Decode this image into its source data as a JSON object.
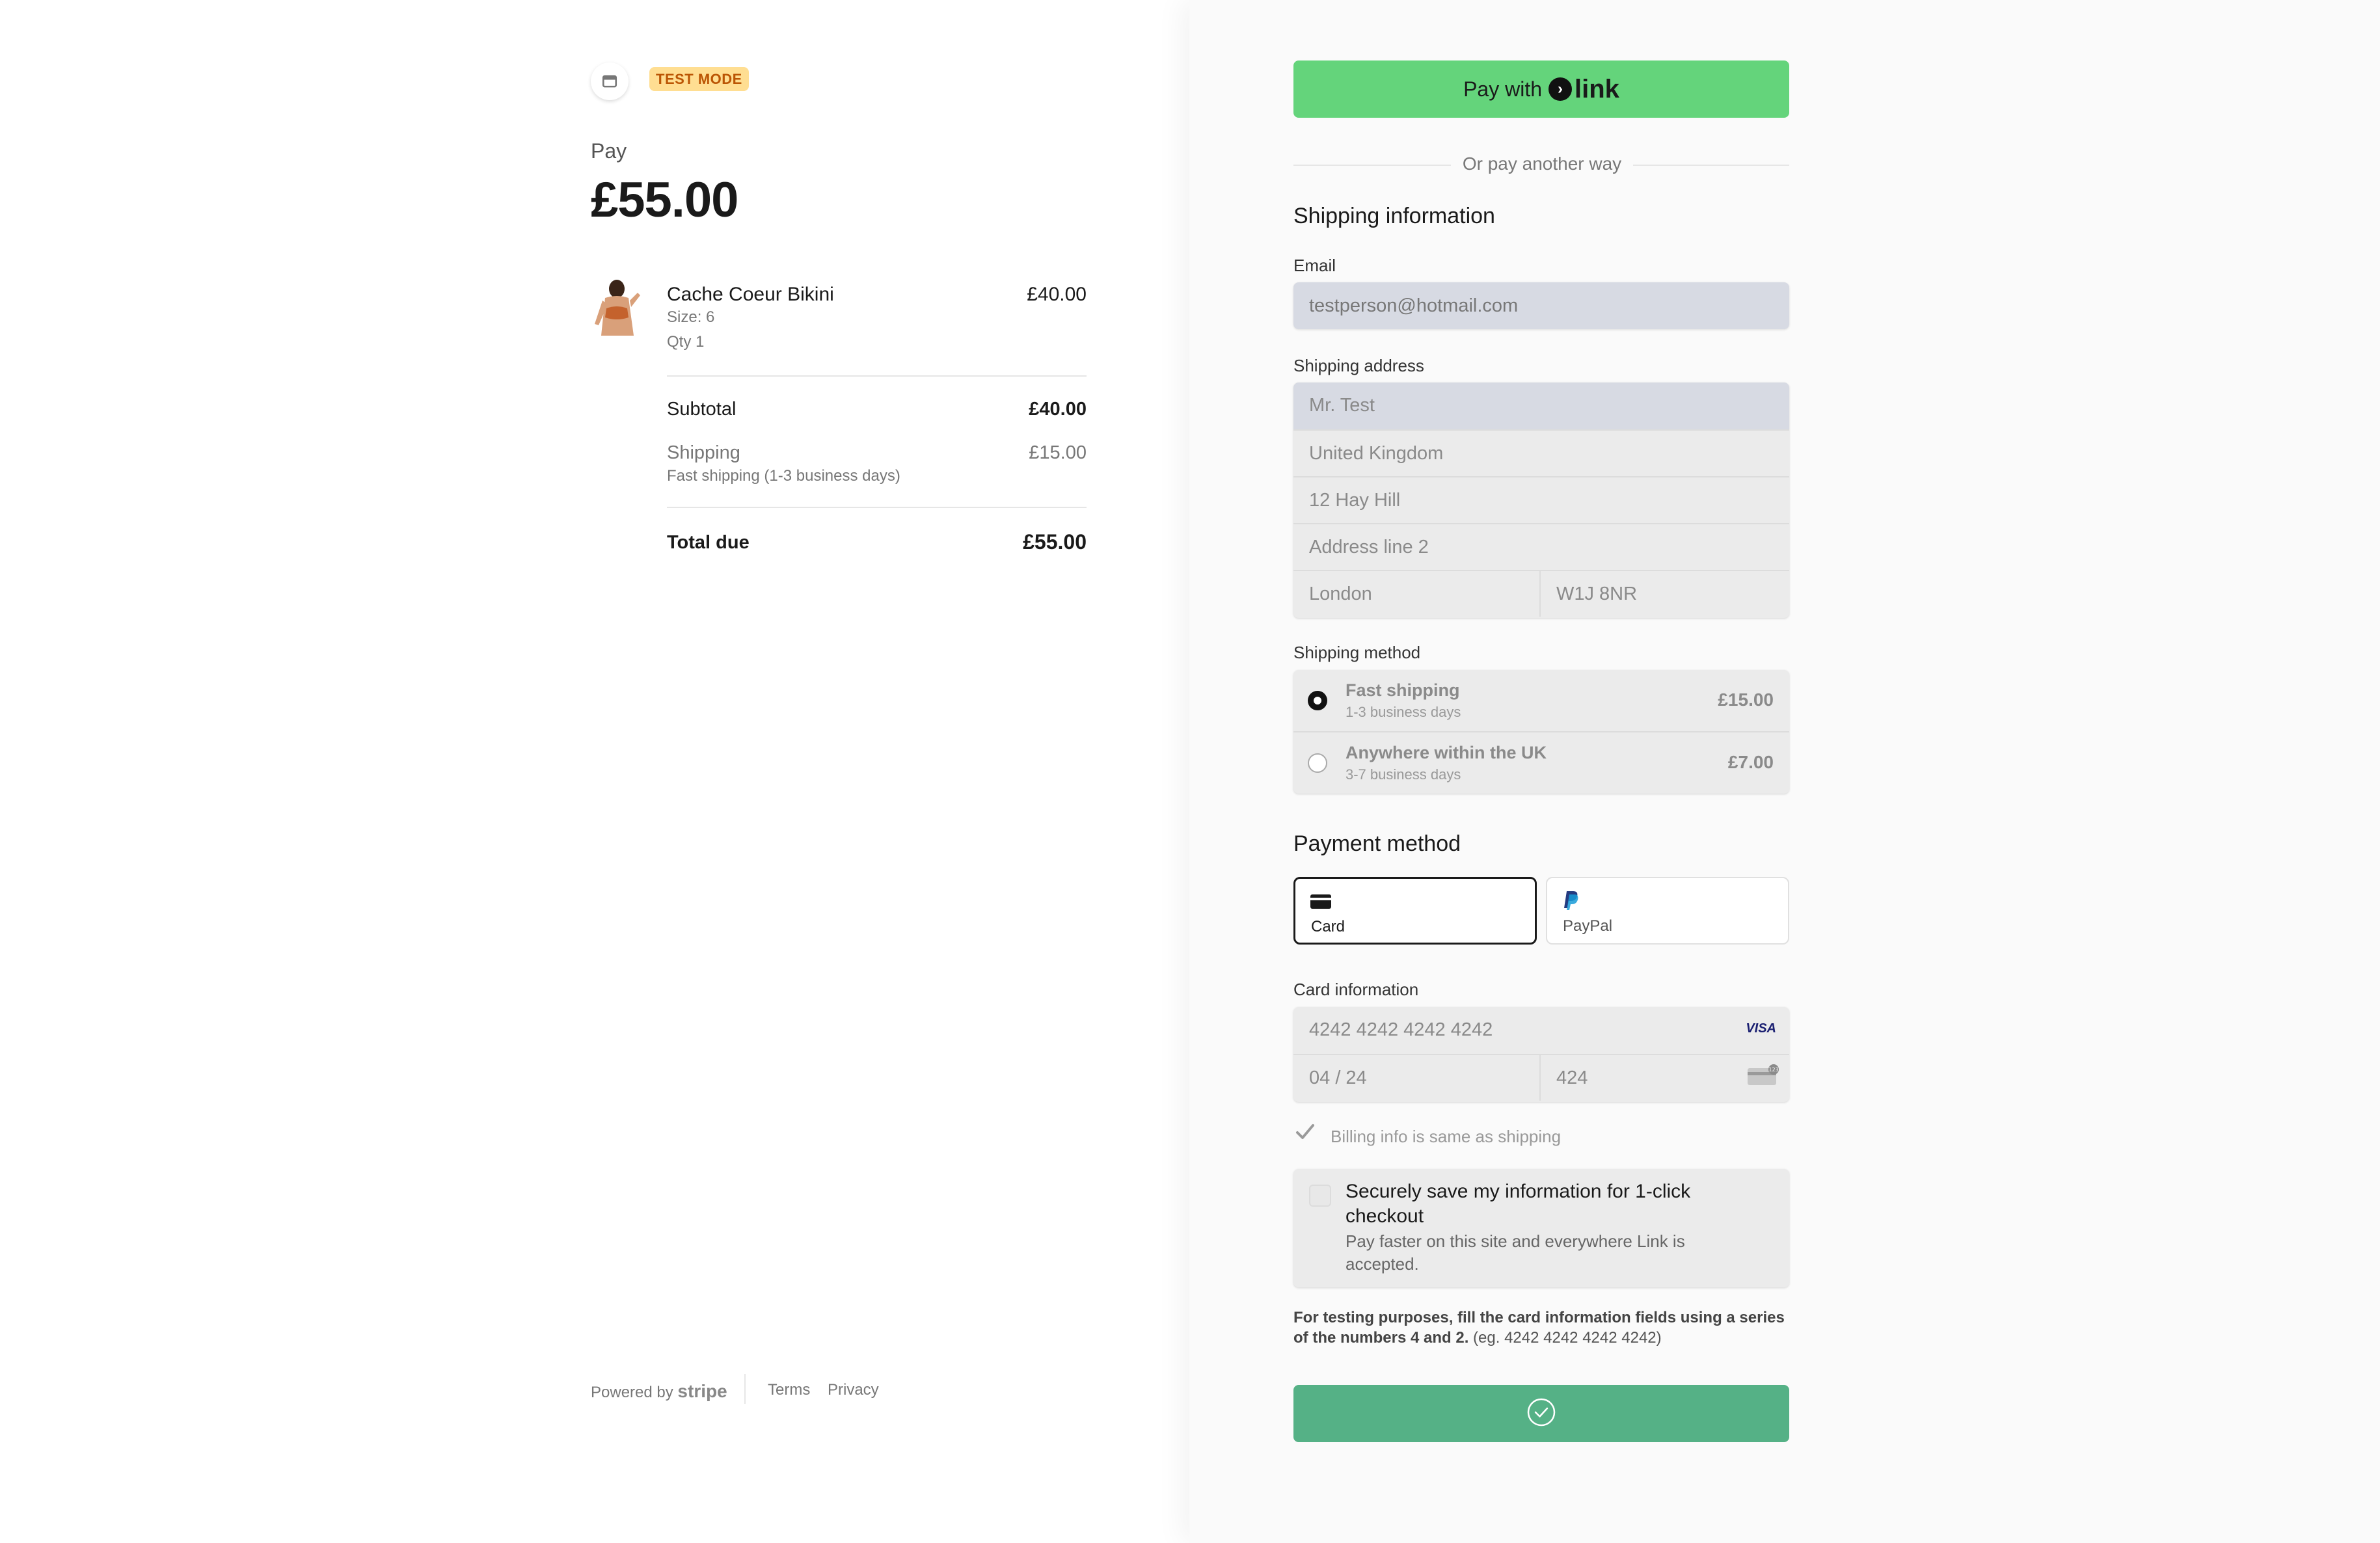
{
  "merchant": {
    "badge": "TEST MODE",
    "icon": "store-icon"
  },
  "summary": {
    "pay_label": "Pay",
    "amount": "£55.00",
    "item": {
      "name": "Cache Coeur Bikini",
      "size": "Size: 6",
      "qty": "Qty 1",
      "price": "£40.00"
    },
    "subtotal_label": "Subtotal",
    "subtotal_value": "£40.00",
    "shipping_label": "Shipping",
    "shipping_detail": "Fast shipping (1-3 business days)",
    "shipping_value": "£15.00",
    "total_label": "Total due",
    "total_value": "£55.00"
  },
  "footer": {
    "powered": "Powered by",
    "brand": "stripe",
    "terms": "Terms",
    "privacy": "Privacy"
  },
  "link_button": {
    "prefix": "Pay with",
    "logo": "link"
  },
  "divider_text": "Or pay another way",
  "shipping": {
    "title": "Shipping information",
    "email_label": "Email",
    "email_value": "testperson@hotmail.com",
    "address_label": "Shipping address",
    "name": "Mr. Test",
    "country": "United Kingdom",
    "line1": "12 Hay Hill",
    "line2_placeholder": "Address line 2",
    "city": "London",
    "postcode": "W1J 8NR",
    "method_label": "Shipping method",
    "options": [
      {
        "title": "Fast shipping",
        "sub": "1-3 business days",
        "price": "£15.00",
        "selected": true
      },
      {
        "title": "Anywhere within the UK",
        "sub": "3-7 business days",
        "price": "£7.00",
        "selected": false
      }
    ]
  },
  "payment": {
    "title": "Payment method",
    "tabs": [
      {
        "label": "Card",
        "icon": "card-icon",
        "selected": true
      },
      {
        "label": "PayPal",
        "icon": "paypal-icon",
        "selected": false
      }
    ],
    "card_label": "Card information",
    "card_number": "4242 4242 4242 4242",
    "card_brand": "VISA",
    "expiry": "04 / 24",
    "cvc": "424",
    "billing_same": "Billing info is same as shipping",
    "save_title": "Securely save my information for 1-click checkout",
    "save_sub": "Pay faster on this site and everywhere Link is accepted.",
    "test_note_bold": "For testing purposes, fill the card information fields using a series of the numbers 4 and 2.",
    "test_note_rest": " (eg. 4242 4242 4242 4242)"
  },
  "colors": {
    "link_green": "#64d47b",
    "submit_green": "#55b186",
    "badge_bg": "#ffde92",
    "badge_text": "#bb5504"
  }
}
